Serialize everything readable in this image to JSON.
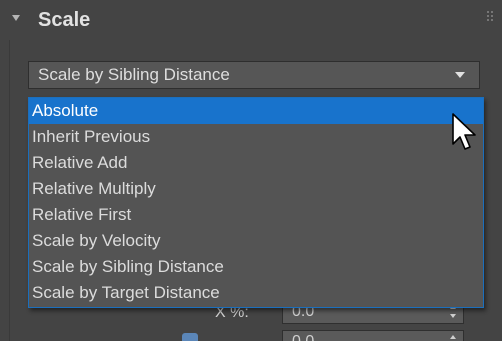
{
  "rollout": {
    "title": "Scale",
    "collapse_icon": "triangle-down-icon",
    "grip_icon": "drag-grip-icon"
  },
  "dropdown": {
    "selected_value": "Scale by Sibling Distance",
    "options": [
      "Absolute",
      "Inherit Previous",
      "Relative Add",
      "Relative Multiply",
      "Relative First",
      "Scale by Velocity",
      "Scale by Sibling Distance",
      "Scale by Target Distance"
    ],
    "highlighted_option": "Absolute"
  },
  "fields": {
    "x_label": "X %:",
    "x_value": "0.0",
    "second_value": "0.0"
  },
  "colors": {
    "panel_bg": "#444444",
    "highlight": "#1873cc",
    "list_border": "#1b6fbd"
  },
  "cursor": {
    "icon": "mouse-pointer-icon"
  }
}
